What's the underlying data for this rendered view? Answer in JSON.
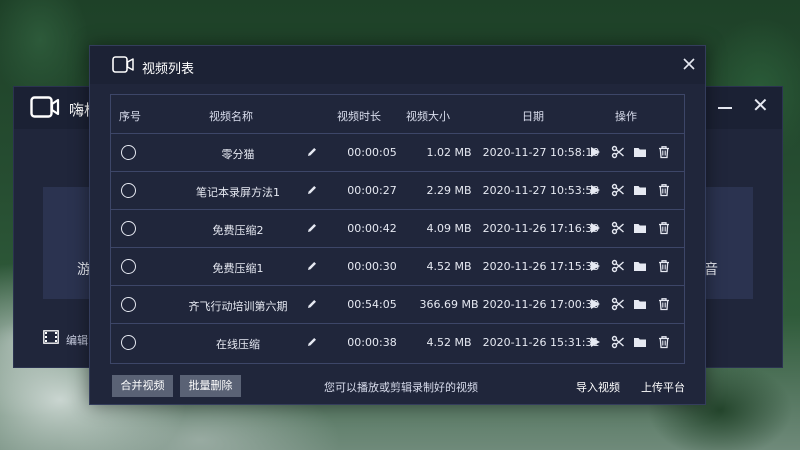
{
  "background_app": {
    "title": "嗨格",
    "left_text": "游",
    "right_text": "音",
    "edit_label": "编辑"
  },
  "dialog": {
    "title": "视频列表",
    "icons": {
      "title": "video-camera-icon",
      "close": "close-icon"
    },
    "columns": {
      "index": "序号",
      "name": "视频名称",
      "duration": "视频时长",
      "size": "视频大小",
      "date": "日期",
      "actions": "操作"
    },
    "rows": [
      {
        "name": "零分猫",
        "duration": "00:00:05",
        "size": "1.02 MB",
        "date": "2020-11-27 10:58:10"
      },
      {
        "name": "笔记本录屏方法1",
        "duration": "00:00:27",
        "size": "2.29 MB",
        "date": "2020-11-27 10:53:53"
      },
      {
        "name": "免费压缩2",
        "duration": "00:00:42",
        "size": "4.09 MB",
        "date": "2020-11-26 17:16:39"
      },
      {
        "name": "免费压缩1",
        "duration": "00:00:30",
        "size": "4.52 MB",
        "date": "2020-11-26 17:15:33"
      },
      {
        "name": "齐飞行动培训第六期",
        "duration": "00:54:05",
        "size": "366.69 MB",
        "date": "2020-11-26 17:00:30"
      },
      {
        "name": "在线压缩",
        "duration": "00:00:38",
        "size": "4.52 MB",
        "date": "2020-11-26 15:31:31"
      }
    ],
    "row_actions": [
      "play-icon",
      "scissors-icon",
      "folder-icon",
      "trash-icon"
    ],
    "footer": {
      "merge_button": "合并视频",
      "batch_delete_button": "批量删除",
      "hint": "您可以播放或剪辑录制好的视频",
      "import_link": "导入视频",
      "upload_link": "上传平台"
    }
  },
  "colors": {
    "panel": "#20263b",
    "titlebar": "#1c2235",
    "grid_line": "#3d4668",
    "button": "#5a6275",
    "text": "#e6e9f2"
  }
}
